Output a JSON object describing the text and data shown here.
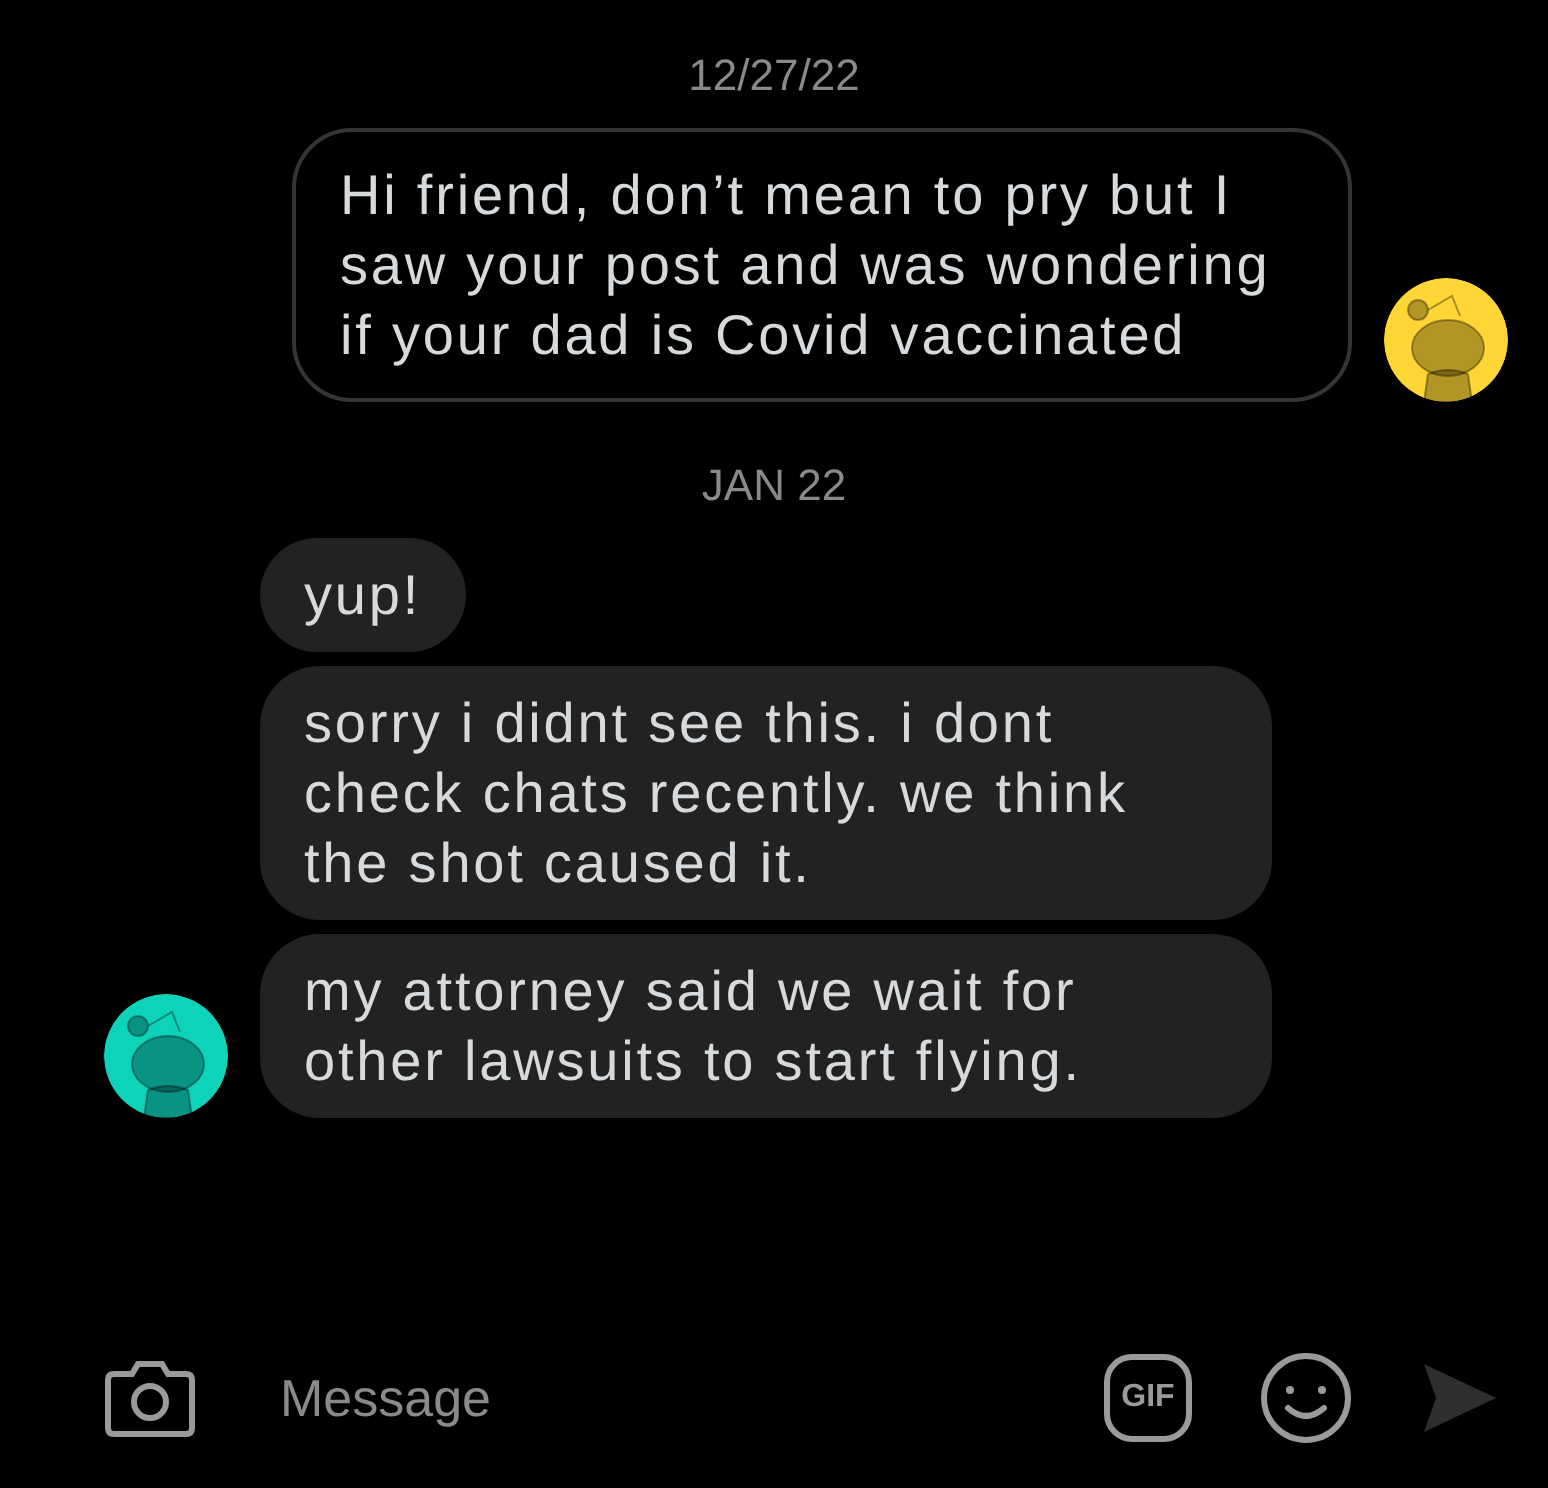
{
  "messages": [
    {
      "kind": "date",
      "text": "12/27/22"
    },
    {
      "kind": "outgoing",
      "color": "#ffd635",
      "bubbles": [
        "Hi friend, don’t mean to pry but I saw your post and was wondering if your dad is Covid vaccinated"
      ]
    },
    {
      "kind": "date",
      "text": "JAN 22"
    },
    {
      "kind": "incoming",
      "color": "#0dd3bb",
      "bubbles": [
        "yup!",
        "sorry i didnt see this. i dont check chats recently. we think the shot caused it.",
        "my attorney said we wait for other lawsuits to start flying."
      ]
    }
  ],
  "composer": {
    "placeholder": "Message",
    "gif_label": "GIF"
  }
}
